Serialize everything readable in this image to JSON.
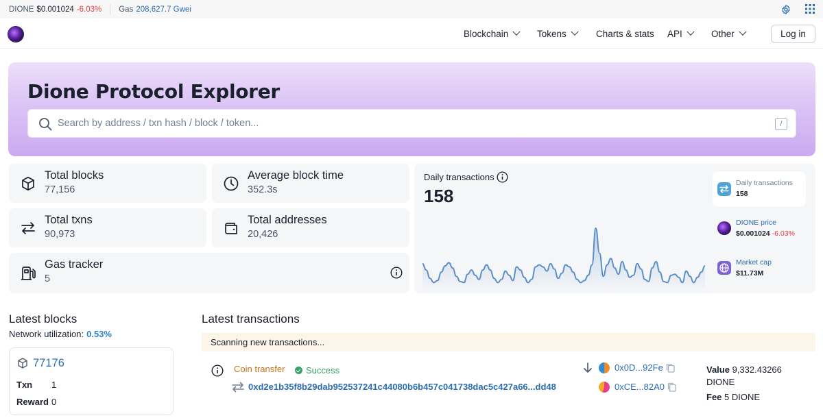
{
  "topbar": {
    "coin_symbol": "DIONE",
    "coin_price": "$0.001024",
    "coin_change": "-6.03%",
    "gas_label": "Gas",
    "gas_value": "208,627.7 Gwei",
    "settings_icon": "gear-icon",
    "apps_icon": "grid-icon"
  },
  "nav": {
    "items": [
      {
        "label": "Blockchain",
        "has_dropdown": true
      },
      {
        "label": "Tokens",
        "has_dropdown": true
      },
      {
        "label": "Charts & stats",
        "has_dropdown": false
      },
      {
        "label": "API",
        "has_dropdown": true
      },
      {
        "label": "Other",
        "has_dropdown": true
      }
    ],
    "login_label": "Log in"
  },
  "hero": {
    "title": "Dione Protocol Explorer",
    "search_placeholder": "Search by address / txn hash / block / token...",
    "search_shortcut": "/"
  },
  "stats": {
    "total_blocks": {
      "label": "Total blocks",
      "value": "77,156",
      "icon": "cube-icon"
    },
    "avg_block_time": {
      "label": "Average block time",
      "value": "352.3s",
      "icon": "clock-icon"
    },
    "total_txns": {
      "label": "Total txns",
      "value": "90,973",
      "icon": "transfer-arrows-icon"
    },
    "total_addresses": {
      "label": "Total addresses",
      "value": "20,426",
      "icon": "wallet-icon"
    },
    "gas_tracker": {
      "label": "Gas tracker",
      "value": "5",
      "icon": "fuel-pump-icon"
    }
  },
  "chart_widget": {
    "title": "Daily transactions",
    "value": "158",
    "side_items": [
      {
        "label": "Daily transactions",
        "value": "158",
        "icon": "transactions-icon",
        "color": "#4fa3d8"
      },
      {
        "label": "DIONE price",
        "value": "$0.001024",
        "change": "-6.03%",
        "icon": "dione-logo-icon",
        "color": "#5a1fa0"
      },
      {
        "label": "Market cap",
        "value": "$11.73M",
        "icon": "globe-icon",
        "color": "#7b63d6"
      }
    ]
  },
  "chart_data": {
    "type": "area",
    "title": "Daily transactions",
    "xlabel": "",
    "ylabel": "",
    "values": [
      42,
      30,
      14,
      6,
      10,
      26,
      38,
      44,
      34,
      18,
      8,
      6,
      22,
      30,
      20,
      12,
      30,
      40,
      30,
      14,
      6,
      12,
      28,
      20,
      10,
      36,
      30,
      16,
      6,
      12,
      36,
      40,
      36,
      28,
      42,
      32,
      14,
      24,
      40,
      36,
      26,
      12,
      6,
      10,
      20,
      40,
      110,
      62,
      18,
      40,
      52,
      34,
      22,
      46,
      30,
      16,
      20,
      42,
      32,
      12,
      8,
      34,
      46,
      26,
      8,
      6,
      20,
      22,
      16,
      6,
      28,
      18,
      6,
      16,
      26,
      38
    ],
    "color": "#5b8fc7",
    "grid": false
  },
  "latest_blocks": {
    "title": "Latest blocks",
    "utilization_label": "Network utilization:",
    "utilization_value": "0.53%",
    "block": {
      "number": "77176",
      "txn_label": "Txn",
      "txn_value": "1",
      "reward_label": "Reward",
      "reward_value": "0"
    }
  },
  "latest_transactions": {
    "title": "Latest transactions",
    "scanning": "Scanning new transactions...",
    "tx": {
      "type": "Coin transfer",
      "status": "Success",
      "hash": "0xd2e1b35f8b29dab952537241c44080b6b457c041738dac5c427a66...dd48",
      "from": "0x0D...92Fe",
      "to": "0xCE...82A0",
      "value_label": "Value",
      "value_amount": "9,332.43266",
      "value_unit": "DIONE",
      "fee_label": "Fee",
      "fee_value": "5 DIONE"
    }
  }
}
